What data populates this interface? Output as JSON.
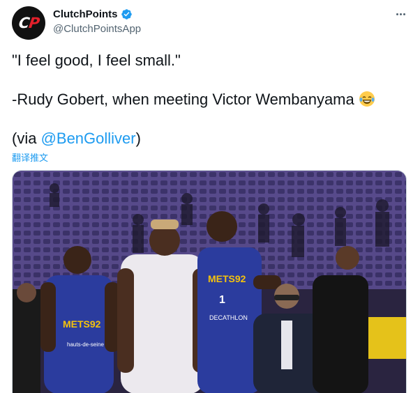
{
  "author": {
    "display_name": "ClutchPoints",
    "handle": "@ClutchPointsApp",
    "avatar_letters": "CP",
    "verified_icon": "verified-badge-icon"
  },
  "tweet": {
    "line1": "\"I feel good, I feel small.\"",
    "line2": "-Rudy Gobert, when meeting Victor Wembanyama",
    "line2_emoji": "😂",
    "line3_prefix": "(via ",
    "line3_mention": "@BenGolliver",
    "line3_suffix": ")",
    "translate_label": "翻译推文"
  },
  "media": {
    "jersey_text": "METS92",
    "jersey_number": "1",
    "sponsor_left": "hauts-de-seine",
    "sponsor_right": "DECATHLON"
  },
  "colors": {
    "accent": "#1d9bf0",
    "text": "#0f1419",
    "secondary": "#536471",
    "brand_red": "#e4202b",
    "jersey_blue": "#2b3c9e",
    "jersey_yellow": "#f4c20d"
  }
}
